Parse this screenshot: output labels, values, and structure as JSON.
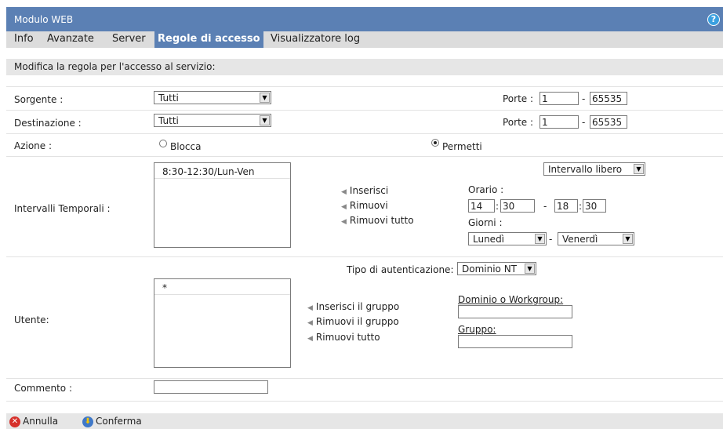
{
  "window": {
    "title": "Modulo WEB"
  },
  "tabs": [
    {
      "label": "Info"
    },
    {
      "label": "Avanzate"
    },
    {
      "label": "Server"
    },
    {
      "label": "Regole di accesso",
      "active": true
    },
    {
      "label": "Visualizzatore log"
    }
  ],
  "section_title": "Modifica la regola per l'accesso al servizio:",
  "source": {
    "label": "Sorgente :",
    "selected": "Tutti",
    "ports_label": "Porte :",
    "port_from": "1",
    "port_sep": "-",
    "port_to": "65535"
  },
  "destination": {
    "label": "Destinazione :",
    "selected": "Tutti",
    "ports_label": "Porte :",
    "port_from": "1",
    "port_sep": "-",
    "port_to": "65535"
  },
  "action": {
    "label": "Azione :",
    "block_label": "Blocca",
    "allow_label": "Permetti",
    "selected": "Permetti"
  },
  "time_intervals": {
    "label": "Intervalli Temporali :",
    "items": [
      "8:30-12:30/Lun-Ven"
    ],
    "insert_label": "Inserisci",
    "remove_label": "Rimuovi",
    "remove_all_label": "Rimuovi tutto",
    "mode_selected": "Intervallo libero",
    "hours_label": "Orario :",
    "start_hour": "14",
    "start_min": "30",
    "end_hour": "18",
    "end_min": "30",
    "hour_sep": "-",
    "time_colon": ":",
    "days_label": "Giorni :",
    "day_from": "Lunedì",
    "day_to": "Venerdì",
    "day_sep": "-"
  },
  "user": {
    "label": "Utente:",
    "auth_type_label": "Tipo di autenticazione:",
    "auth_type_selected": "Dominio NT",
    "items": [
      "*"
    ],
    "insert_group_label": "Inserisci il gruppo",
    "remove_group_label": "Rimuovi il gruppo",
    "remove_all_label": "Rimuovi tutto",
    "domain_label": "Dominio o Workgroup:",
    "domain_value": "",
    "group_label": "Gruppo:",
    "group_value": ""
  },
  "comment": {
    "label": "Commento :",
    "value": ""
  },
  "footer": {
    "cancel_label": "Annulla",
    "confirm_label": "Conferma"
  },
  "colors": {
    "header_blue": "#5b80b4",
    "cancel_red": "#d6312b",
    "confirm_blue": "#3f78c8"
  },
  "icons": {
    "help": "help-icon",
    "cancel": "cancel-icon",
    "confirm": "confirm-icon",
    "arrow": "triangle-left-icon",
    "dropdown": "chevron-down-icon"
  }
}
